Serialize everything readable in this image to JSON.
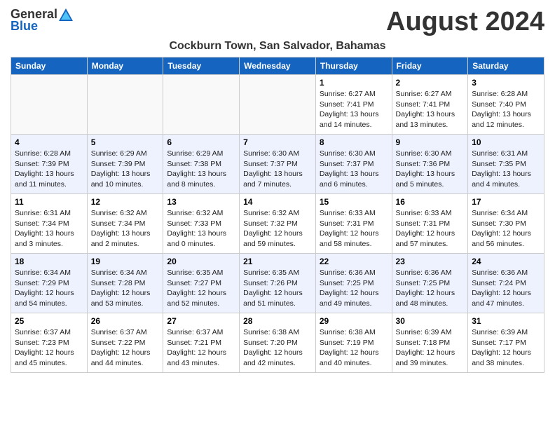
{
  "header": {
    "logo_general": "General",
    "logo_blue": "Blue",
    "month_title": "August 2024",
    "location": "Cockburn Town, San Salvador, Bahamas"
  },
  "weekdays": [
    "Sunday",
    "Monday",
    "Tuesday",
    "Wednesday",
    "Thursday",
    "Friday",
    "Saturday"
  ],
  "weeks": [
    [
      {
        "day": "",
        "info": ""
      },
      {
        "day": "",
        "info": ""
      },
      {
        "day": "",
        "info": ""
      },
      {
        "day": "",
        "info": ""
      },
      {
        "day": "1",
        "info": "Sunrise: 6:27 AM\nSunset: 7:41 PM\nDaylight: 13 hours\nand 14 minutes."
      },
      {
        "day": "2",
        "info": "Sunrise: 6:27 AM\nSunset: 7:41 PM\nDaylight: 13 hours\nand 13 minutes."
      },
      {
        "day": "3",
        "info": "Sunrise: 6:28 AM\nSunset: 7:40 PM\nDaylight: 13 hours\nand 12 minutes."
      }
    ],
    [
      {
        "day": "4",
        "info": "Sunrise: 6:28 AM\nSunset: 7:39 PM\nDaylight: 13 hours\nand 11 minutes."
      },
      {
        "day": "5",
        "info": "Sunrise: 6:29 AM\nSunset: 7:39 PM\nDaylight: 13 hours\nand 10 minutes."
      },
      {
        "day": "6",
        "info": "Sunrise: 6:29 AM\nSunset: 7:38 PM\nDaylight: 13 hours\nand 8 minutes."
      },
      {
        "day": "7",
        "info": "Sunrise: 6:30 AM\nSunset: 7:37 PM\nDaylight: 13 hours\nand 7 minutes."
      },
      {
        "day": "8",
        "info": "Sunrise: 6:30 AM\nSunset: 7:37 PM\nDaylight: 13 hours\nand 6 minutes."
      },
      {
        "day": "9",
        "info": "Sunrise: 6:30 AM\nSunset: 7:36 PM\nDaylight: 13 hours\nand 5 minutes."
      },
      {
        "day": "10",
        "info": "Sunrise: 6:31 AM\nSunset: 7:35 PM\nDaylight: 13 hours\nand 4 minutes."
      }
    ],
    [
      {
        "day": "11",
        "info": "Sunrise: 6:31 AM\nSunset: 7:34 PM\nDaylight: 13 hours\nand 3 minutes."
      },
      {
        "day": "12",
        "info": "Sunrise: 6:32 AM\nSunset: 7:34 PM\nDaylight: 13 hours\nand 2 minutes."
      },
      {
        "day": "13",
        "info": "Sunrise: 6:32 AM\nSunset: 7:33 PM\nDaylight: 13 hours\nand 0 minutes."
      },
      {
        "day": "14",
        "info": "Sunrise: 6:32 AM\nSunset: 7:32 PM\nDaylight: 12 hours\nand 59 minutes."
      },
      {
        "day": "15",
        "info": "Sunrise: 6:33 AM\nSunset: 7:31 PM\nDaylight: 12 hours\nand 58 minutes."
      },
      {
        "day": "16",
        "info": "Sunrise: 6:33 AM\nSunset: 7:31 PM\nDaylight: 12 hours\nand 57 minutes."
      },
      {
        "day": "17",
        "info": "Sunrise: 6:34 AM\nSunset: 7:30 PM\nDaylight: 12 hours\nand 56 minutes."
      }
    ],
    [
      {
        "day": "18",
        "info": "Sunrise: 6:34 AM\nSunset: 7:29 PM\nDaylight: 12 hours\nand 54 minutes."
      },
      {
        "day": "19",
        "info": "Sunrise: 6:34 AM\nSunset: 7:28 PM\nDaylight: 12 hours\nand 53 minutes."
      },
      {
        "day": "20",
        "info": "Sunrise: 6:35 AM\nSunset: 7:27 PM\nDaylight: 12 hours\nand 52 minutes."
      },
      {
        "day": "21",
        "info": "Sunrise: 6:35 AM\nSunset: 7:26 PM\nDaylight: 12 hours\nand 51 minutes."
      },
      {
        "day": "22",
        "info": "Sunrise: 6:36 AM\nSunset: 7:25 PM\nDaylight: 12 hours\nand 49 minutes."
      },
      {
        "day": "23",
        "info": "Sunrise: 6:36 AM\nSunset: 7:25 PM\nDaylight: 12 hours\nand 48 minutes."
      },
      {
        "day": "24",
        "info": "Sunrise: 6:36 AM\nSunset: 7:24 PM\nDaylight: 12 hours\nand 47 minutes."
      }
    ],
    [
      {
        "day": "25",
        "info": "Sunrise: 6:37 AM\nSunset: 7:23 PM\nDaylight: 12 hours\nand 45 minutes."
      },
      {
        "day": "26",
        "info": "Sunrise: 6:37 AM\nSunset: 7:22 PM\nDaylight: 12 hours\nand 44 minutes."
      },
      {
        "day": "27",
        "info": "Sunrise: 6:37 AM\nSunset: 7:21 PM\nDaylight: 12 hours\nand 43 minutes."
      },
      {
        "day": "28",
        "info": "Sunrise: 6:38 AM\nSunset: 7:20 PM\nDaylight: 12 hours\nand 42 minutes."
      },
      {
        "day": "29",
        "info": "Sunrise: 6:38 AM\nSunset: 7:19 PM\nDaylight: 12 hours\nand 40 minutes."
      },
      {
        "day": "30",
        "info": "Sunrise: 6:39 AM\nSunset: 7:18 PM\nDaylight: 12 hours\nand 39 minutes."
      },
      {
        "day": "31",
        "info": "Sunrise: 6:39 AM\nSunset: 7:17 PM\nDaylight: 12 hours\nand 38 minutes."
      }
    ]
  ]
}
